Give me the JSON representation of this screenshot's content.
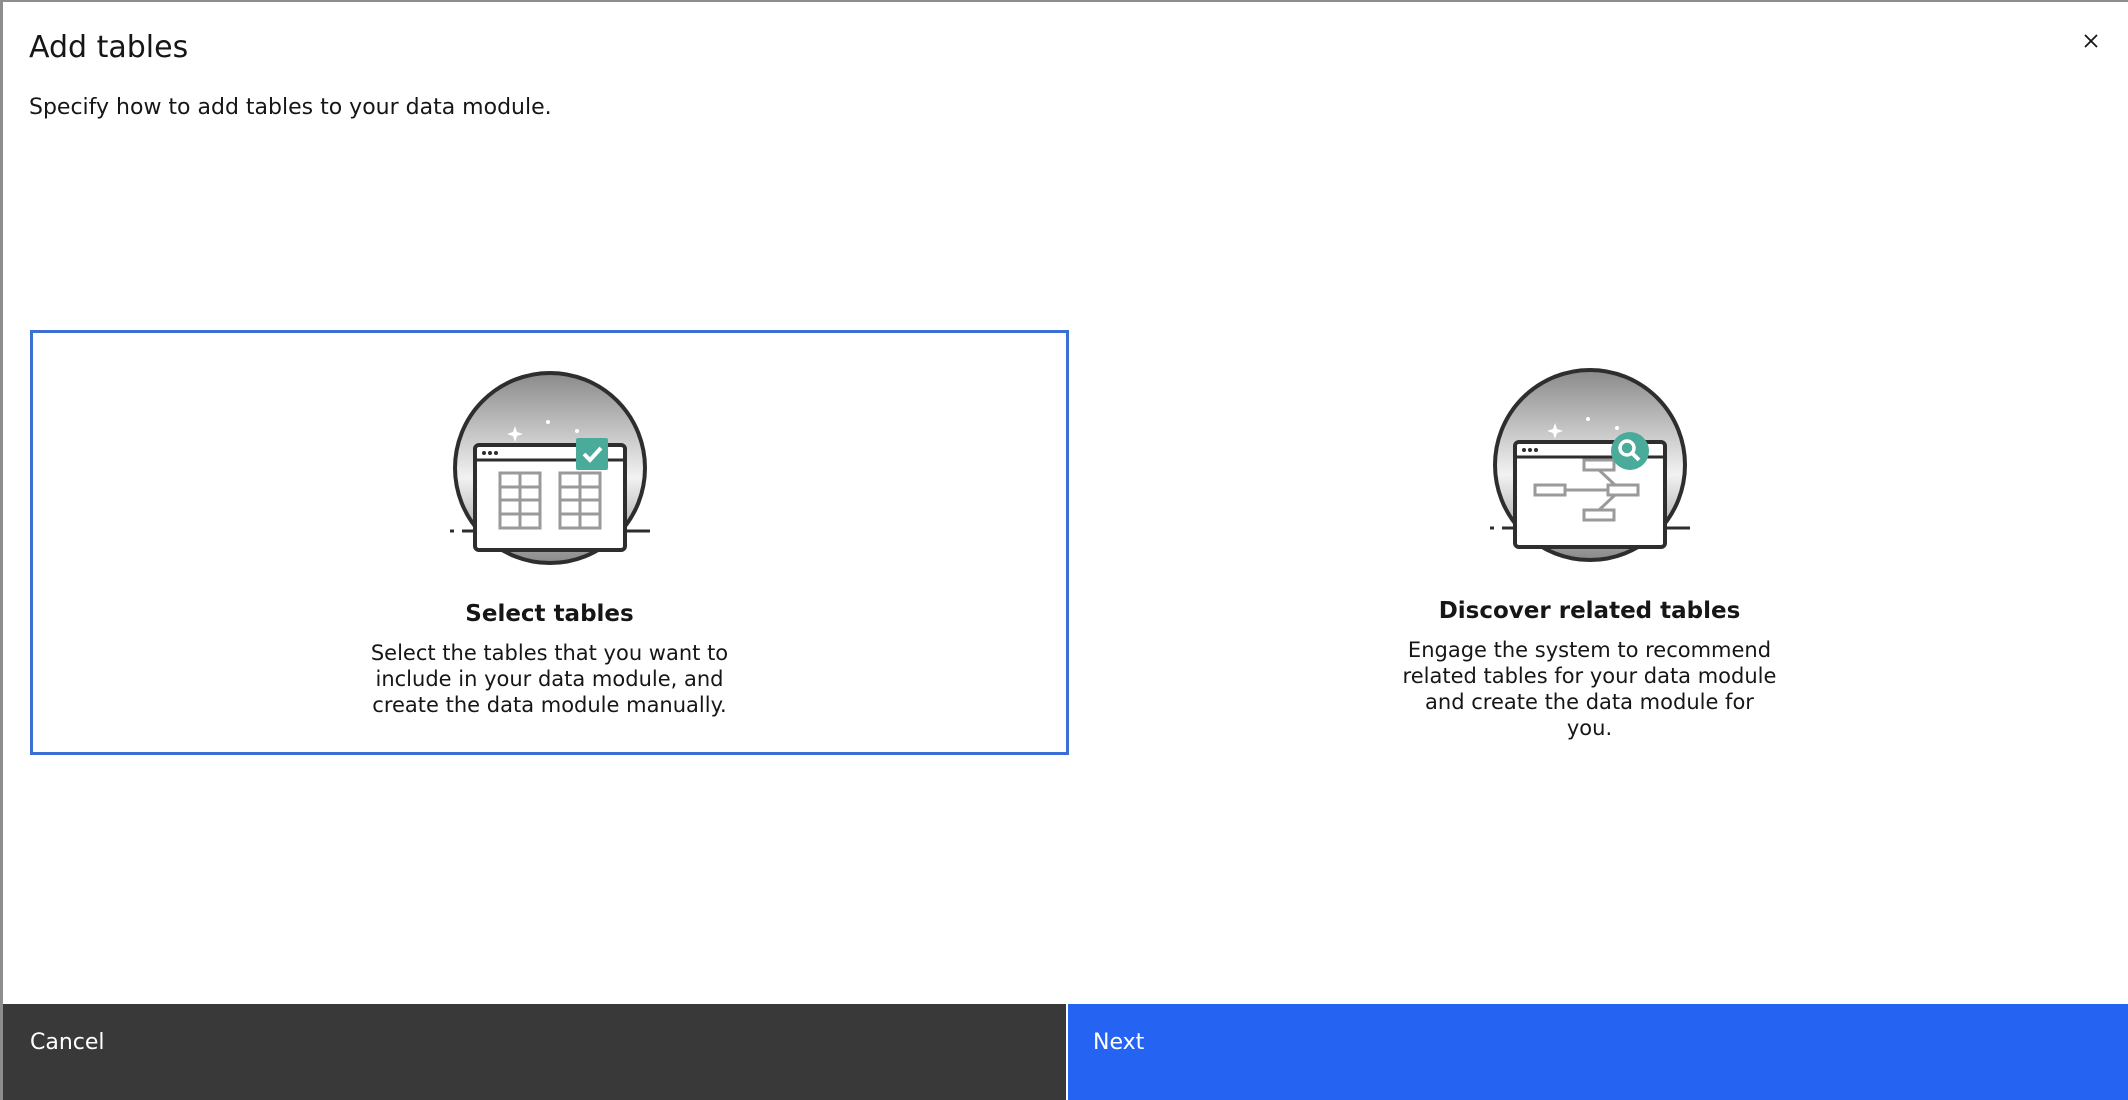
{
  "dialog": {
    "title": "Add tables",
    "subtitle": "Specify how to add tables to your data module."
  },
  "options": [
    {
      "title": "Select tables",
      "description": "Select the tables that you want to include in your data module, and create the data module manually.",
      "selected": true,
      "icon": "table-select-icon"
    },
    {
      "title": "Discover related tables",
      "description": "Engage the system to recommend related tables for your data module and create the data module for you.",
      "selected": false,
      "icon": "discover-tables-icon"
    }
  ],
  "footer": {
    "cancel_label": "Cancel",
    "next_label": "Next"
  },
  "colors": {
    "selected_border": "#3c6fd4",
    "primary_button": "#2563f2",
    "secondary_button": "#393939",
    "badge": "#4aab9a"
  }
}
